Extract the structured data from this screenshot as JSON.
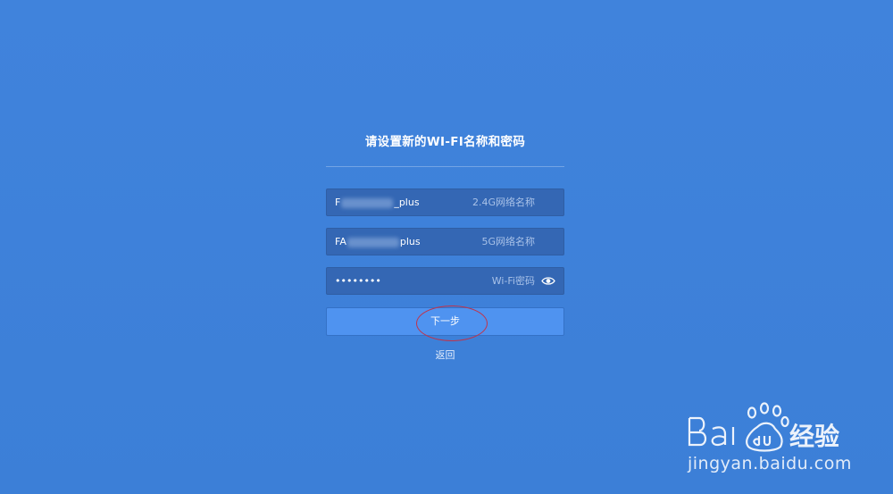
{
  "form": {
    "title": "请设置新的WI-FI名称和密码",
    "ssid_24": {
      "prefix": "F",
      "suffix": "_plus",
      "hint": "2.4G网络名称"
    },
    "ssid_5g": {
      "prefix": "FA",
      "suffix": "plus",
      "hint": "5G网络名称"
    },
    "password": {
      "value": "••••••••",
      "hint": "Wi-Fi密码",
      "icon": "eye-icon"
    },
    "next_button": "下一步",
    "back_link": "返回"
  },
  "watermark": {
    "logo_text": "Bai du 经验",
    "url": "jingyan.baidu.com"
  },
  "colors": {
    "background": "#3f80d8",
    "field_bg": "#3467b4",
    "button_bg": "#4f93f0",
    "highlight_circle": "#c0334a"
  }
}
